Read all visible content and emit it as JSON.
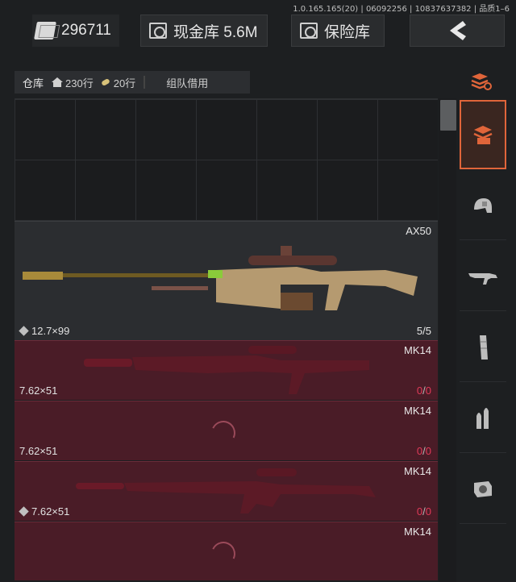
{
  "version_text": "1.0.165.165(20) | 06092256 | 10837637382 | 品质1–6",
  "topbar": {
    "money_value": "296711",
    "cash_vault_label": "现金库 5.6M",
    "safe_label": "保险库"
  },
  "tabs": {
    "warehouse": "仓库",
    "house_rows": "230行",
    "ammo_rows": "20行",
    "team_borrow": "组队借用"
  },
  "items": [
    {
      "name": "AX50",
      "caliber": "12.7×99",
      "count": "5/5",
      "show_cube": true
    },
    {
      "name": "MK14",
      "caliber": "7.62×51",
      "count_num": "0",
      "count_den": "0",
      "show_cube": false
    },
    {
      "name": "MK14",
      "caliber": "7.62×51",
      "count_num": "0",
      "count_den": "0",
      "show_cube": false
    },
    {
      "name": "MK14",
      "caliber": "7.62×51",
      "count_num": "0",
      "count_den": "0",
      "show_cube": true
    },
    {
      "name": "MK14",
      "caliber": "",
      "count_num": "",
      "count_den": "",
      "show_cube": false
    }
  ],
  "sidebar": [
    "stack-refresh-icon",
    "storage-icon",
    "helmet-icon",
    "rifle-icon",
    "magazine-icon",
    "ammo-icon",
    "sight-icon"
  ],
  "colors": {
    "accent": "#e0653a",
    "mk_row_bg": "#4a1c27",
    "zero_count": "#e03a59"
  }
}
